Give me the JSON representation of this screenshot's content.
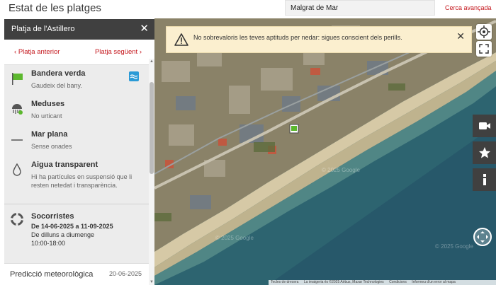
{
  "header": {
    "title": "Estat de les platges",
    "search_value": "Malgrat de Mar",
    "advanced_search": "Cerca avançada"
  },
  "panel": {
    "title": "Platja de l'Astillero",
    "close_glyph": "✕",
    "prev_label": "Platja anterior",
    "next_label": "Platja següent",
    "conditions": [
      {
        "icon": "green-flag-icon",
        "title": "Bandera verda",
        "subtitle": "Gaudeix del bany."
      },
      {
        "icon": "jellyfish-icon",
        "title": "Meduses",
        "subtitle": "No urticant"
      },
      {
        "icon": "flat-sea-icon",
        "title": "Mar plana",
        "subtitle": "Sense onades"
      },
      {
        "icon": "water-drop-icon",
        "title": "Aigua transparent",
        "subtitle": "Hi ha partícules en suspensió que li resten netedat i transparència."
      }
    ],
    "lifeguard": {
      "title": "Socorristes",
      "dates": "De 14-06-2025 a 11-09-2025",
      "days": "De dilluns a diumenge",
      "hours": "10:00-18:00"
    },
    "forecast": {
      "title": "Predicció meteorològica",
      "date": "20-06-2025"
    }
  },
  "map": {
    "warning": "No sobrevaloris les teves aptituds per nedar: sigues conscient dels perills.",
    "watermark": "© 2025 Google",
    "attribution": [
      "Tecles de drecera",
      "La imatgeria és ©2025 Airbus, Maxar Technologies",
      "Condicions",
      "Informeu d'un error al mapa"
    ]
  },
  "colors": {
    "accent": "#c4161c",
    "panel_header": "#404040",
    "flag": "#5cb82e"
  }
}
